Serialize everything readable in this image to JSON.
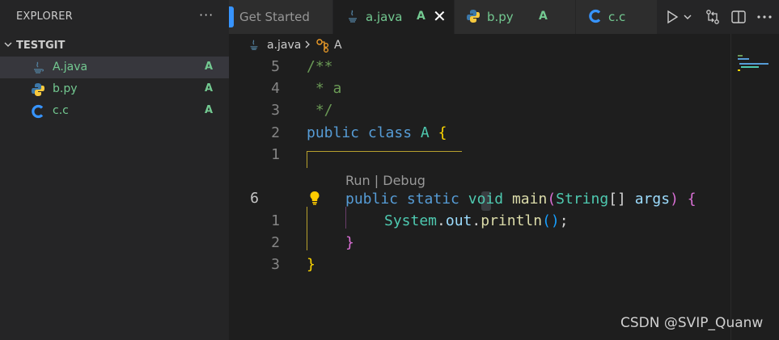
{
  "explorer": {
    "title": "EXPLORER",
    "more_icon": "ellipsis-icon",
    "folder": {
      "name": "TESTGIT",
      "expanded": true
    },
    "files": [
      {
        "name": "A.java",
        "badge": "A",
        "icon": "java-icon",
        "selected": true
      },
      {
        "name": "b.py",
        "badge": "A",
        "icon": "python-icon",
        "selected": false
      },
      {
        "name": "c.c",
        "badge": "A",
        "icon": "c-icon",
        "selected": false
      }
    ]
  },
  "tabs": [
    {
      "label": "Get Started",
      "active": false,
      "badge": ""
    },
    {
      "label": "a.java",
      "active": true,
      "badge": "A",
      "close": "✕"
    },
    {
      "label": "b.py",
      "active": false,
      "badge": "A"
    },
    {
      "label": "c.c",
      "active": false,
      "badge": ""
    }
  ],
  "toolbar": {
    "icons": [
      "run-icon",
      "chevron-down-icon",
      "compare-changes-icon",
      "split-editor-icon",
      "more-icon"
    ]
  },
  "breadcrumb": {
    "file": "a.java",
    "symbol": "A"
  },
  "editor": {
    "line_numbers": [
      "5",
      "4",
      "3",
      "2",
      "1",
      "6",
      "1",
      "2",
      "3"
    ],
    "current_line": "6",
    "codelens": "Run | Debug",
    "code": {
      "l1_comment": "/**",
      "l2_comment": " * a",
      "l3_comment": " */",
      "l4_public": "public",
      "l4_class": "class",
      "l4_name": "A",
      "l4_brace": "{",
      "l6_public": "public",
      "l6_static": "static",
      "l6_void": "void",
      "l6_main": "main",
      "l6_paren_open": "(",
      "l6_string": "String",
      "l6_brackets": "[]",
      "l6_args": "args",
      "l6_paren_close": ")",
      "l6_brace": "{",
      "l7_system": "System",
      "l7_dot1": ".",
      "l7_out": "out",
      "l7_dot2": ".",
      "l7_println": "println",
      "l7_parens": "()",
      "l7_semi": ";",
      "l8_brace": "}",
      "l9_brace": "}"
    },
    "colors": {
      "comment": "#6a9955",
      "keyword": "#569cd6",
      "type": "#4ec9b0",
      "function": "#dcdcaa",
      "variable": "#9cdcfe",
      "brace_gold": "#ffd700",
      "brace_pink": "#da70d6",
      "paren_blue": "#179fff",
      "git_added": "#73c991"
    }
  },
  "watermark": "CSDN @SVIP_Quanw"
}
